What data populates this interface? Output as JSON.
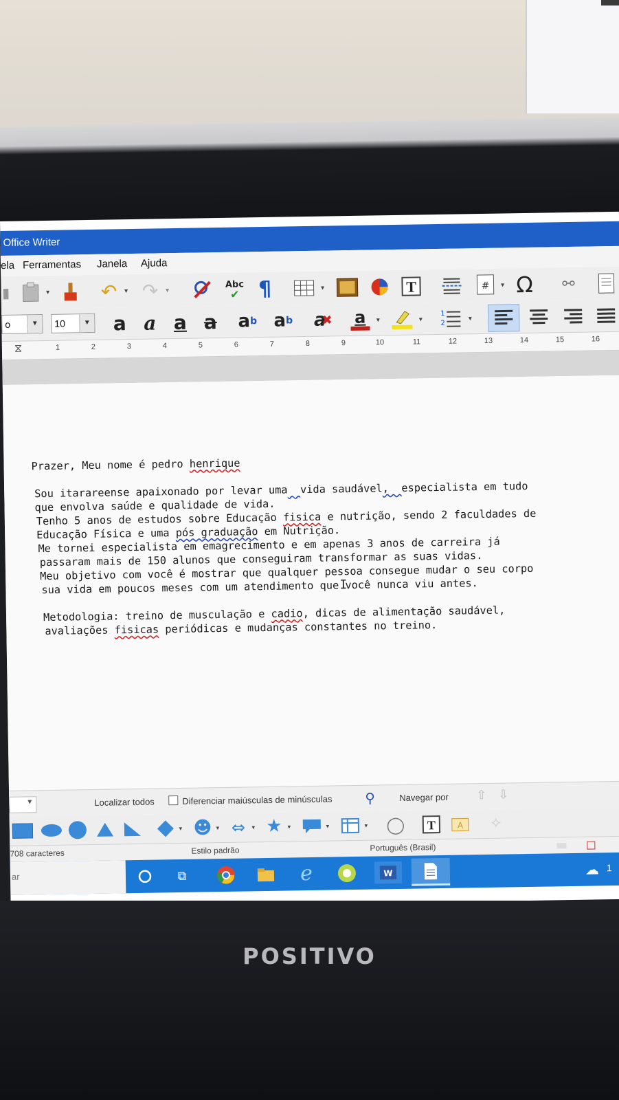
{
  "window": {
    "title": "Office Writer"
  },
  "menu": [
    {
      "label": "ela",
      "name": "menu-tabela"
    },
    {
      "label": "Ferramentas",
      "name": "menu-ferramentas"
    },
    {
      "label": "Janela",
      "name": "menu-janela"
    },
    {
      "label": "Ajuda",
      "name": "menu-ajuda"
    }
  ],
  "toolbar": {
    "font_name_value": "o",
    "font_size_value": "10",
    "spellcheck_icon_label": "Abc"
  },
  "ruler": {
    "ticks": [
      "1",
      "2",
      "3",
      "4",
      "5",
      "6",
      "7",
      "8",
      "9",
      "10",
      "11",
      "12",
      "13",
      "14",
      "15",
      "16"
    ]
  },
  "document": {
    "greeting_prefix": "Prazer, Meu nome é pedro ",
    "greeting_name": "henrique",
    "p1_l1_a": "Sou itarareense apaixonado por levar uma",
    "p1_l1_b": "  ",
    "p1_l1_c": "vida saudável",
    "p1_l1_d": ",  ",
    "p1_l1_e": "especialista em tudo",
    "p1_l2": "que envolva saúde e qualidade de vida.",
    "p1_l3_a": "Tenho 5 anos de estudos sobre Educação ",
    "p1_l3_b": "fisica",
    "p1_l3_c": " e nutrição, sendo 2 faculdades de",
    "p1_l4_a": "Educação Física e uma ",
    "p1_l4_b": "pós graduação",
    "p1_l4_c": " em Nutrição.",
    "p1_l5": "Me tornei especialista em emagrecimento e em apenas 3 anos de carreira já",
    "p1_l6": "passaram mais de 150 alunos que conseguiram transformar as suas vidas.",
    "p1_l7": "Meu objetivo com você é mostrar que qualquer pessoa consegue mudar o seu corpo",
    "p1_l8": "sua vida em poucos meses com um atendimento que você nunca viu antes.",
    "p2_l1_a": "Metodologia: treino de musculação e ",
    "p2_l1_b": "cadio",
    "p2_l1_c": ", dicas de alimentação saudável,",
    "p2_l2_a": "avaliações ",
    "p2_l2_b": "fisicas",
    "p2_l2_c": " periódicas e mudanças constantes no treino."
  },
  "findbar": {
    "find_all": "Localizar todos",
    "match_case": "Diferenciar maiúsculas de minúsculas",
    "navigate_by": "Navegar por"
  },
  "status": {
    "chars": "708 caracteres",
    "style": "Estilo padrão",
    "language": "Português (Brasil)"
  },
  "taskbar": {
    "search_text": "ar",
    "clock_partial": "1"
  },
  "monitor": {
    "brand": "POSITIVO"
  },
  "colors": {
    "titlebar": "#1f5fc8",
    "taskbar": "#1a78d6",
    "spell_error": "#d02020",
    "grammar_error": "#2040c0",
    "font_color": "#c0201a",
    "highlight": "#f2e21c"
  }
}
